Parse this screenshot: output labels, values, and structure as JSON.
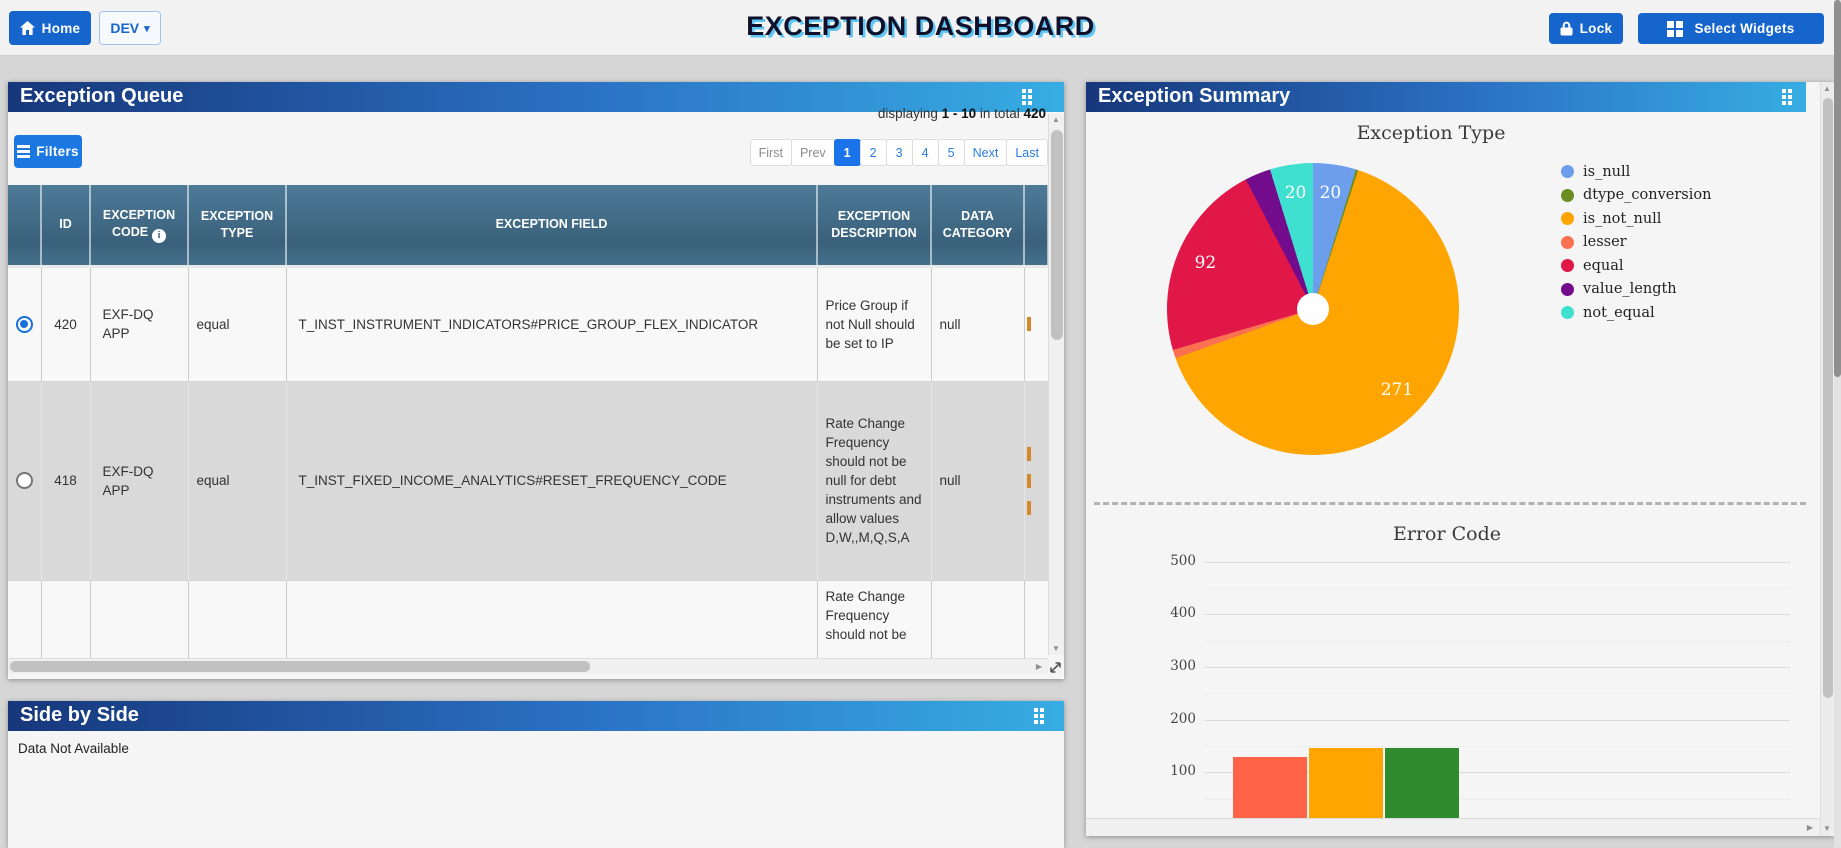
{
  "topbar": {
    "home_label": "Home",
    "env_label": "DEV",
    "title": "EXCEPTION DASHBOARD",
    "lock_label": "Lock",
    "select_widgets_label": "Select Widgets"
  },
  "queue": {
    "title": "Exception Queue",
    "filters_label": "Filters",
    "displaying": {
      "prefix": "displaying",
      "range": "1 - 10",
      "middle": "in total",
      "total": "420"
    },
    "pagination": {
      "items": [
        {
          "label": "First",
          "style": "muted"
        },
        {
          "label": "Prev",
          "style": "muted"
        },
        {
          "label": "1",
          "style": "active"
        },
        {
          "label": "2",
          "style": "link"
        },
        {
          "label": "3",
          "style": "link"
        },
        {
          "label": "4",
          "style": "link"
        },
        {
          "label": "5",
          "style": "link"
        },
        {
          "label": "Next",
          "style": "link"
        },
        {
          "label": "Last",
          "style": "link"
        }
      ]
    },
    "table": {
      "columns": [
        {
          "label": ""
        },
        {
          "label": "ID"
        },
        {
          "label": "EXCEPTION CODE",
          "info": true
        },
        {
          "label": "EXCEPTION TYPE"
        },
        {
          "label": "EXCEPTION FIELD"
        },
        {
          "label": "EXCEPTION DESCRIPTION"
        },
        {
          "label": "DATA CATEGORY"
        },
        {
          "label": ""
        }
      ],
      "rows": [
        {
          "selected": true,
          "id": "420",
          "code": "EXF-DQ APP",
          "type": "equal",
          "field": "T_INST_INSTRUMENT_INDICATORS#PRICE_GROUP_FLEX_INDICATOR",
          "description": "Price Group if not Null should be set to IP",
          "category": "null",
          "clip_marks": 1,
          "shade": "light"
        },
        {
          "selected": false,
          "id": "418",
          "code": "EXF-DQ APP",
          "type": "equal",
          "field": "T_INST_FIXED_INCOME_ANALYTICS#RESET_FREQUENCY_CODE",
          "description": "Rate Change Frequency should not be null for debt instruments and allow values D,W,,M,Q,S,A",
          "category": "null",
          "clip_marks": 3,
          "shade": "dark"
        },
        {
          "selected": null,
          "id": "",
          "code": "",
          "type": "",
          "field": "",
          "description": "Rate Change Frequency should not be",
          "category": "",
          "clip_marks": 0,
          "shade": "light",
          "partial": true
        }
      ]
    }
  },
  "side_by_side": {
    "title": "Side by Side",
    "empty_text": "Data Not Available"
  },
  "summary": {
    "title": "Exception Summary"
  },
  "chart_data": [
    {
      "type": "pie",
      "title": "Exception Type",
      "total": 420,
      "donut": true,
      "legend_position": "right",
      "slices": [
        {
          "label": "is_null",
          "value": 20,
          "color": "#6d9eeb",
          "show_value": true
        },
        {
          "label": "dtype_conversion",
          "value": 1,
          "color": "#6b8e23",
          "show_value": false
        },
        {
          "label": "is_not_null",
          "value": 271,
          "color": "#ffa502",
          "show_value": true
        },
        {
          "label": "lesser",
          "value": 4,
          "color": "#f97150",
          "show_value": false
        },
        {
          "label": "equal",
          "value": 92,
          "color": "#e01747",
          "show_value": true
        },
        {
          "label": "value_length",
          "value": 12,
          "color": "#730c8c",
          "show_value": false
        },
        {
          "label": "not_equal",
          "value": 20,
          "color": "#3fe0d0",
          "show_value": true
        }
      ]
    },
    {
      "type": "bar",
      "title": "Error Code",
      "categories": [
        "",
        "",
        ""
      ],
      "values": [
        129,
        146,
        146
      ],
      "colors": [
        "#ff6347",
        "#ffa502",
        "#2e8b2e"
      ],
      "ylim": [
        0,
        500
      ],
      "yticks": [
        100,
        200,
        300,
        400,
        500
      ],
      "grid": true
    }
  ]
}
